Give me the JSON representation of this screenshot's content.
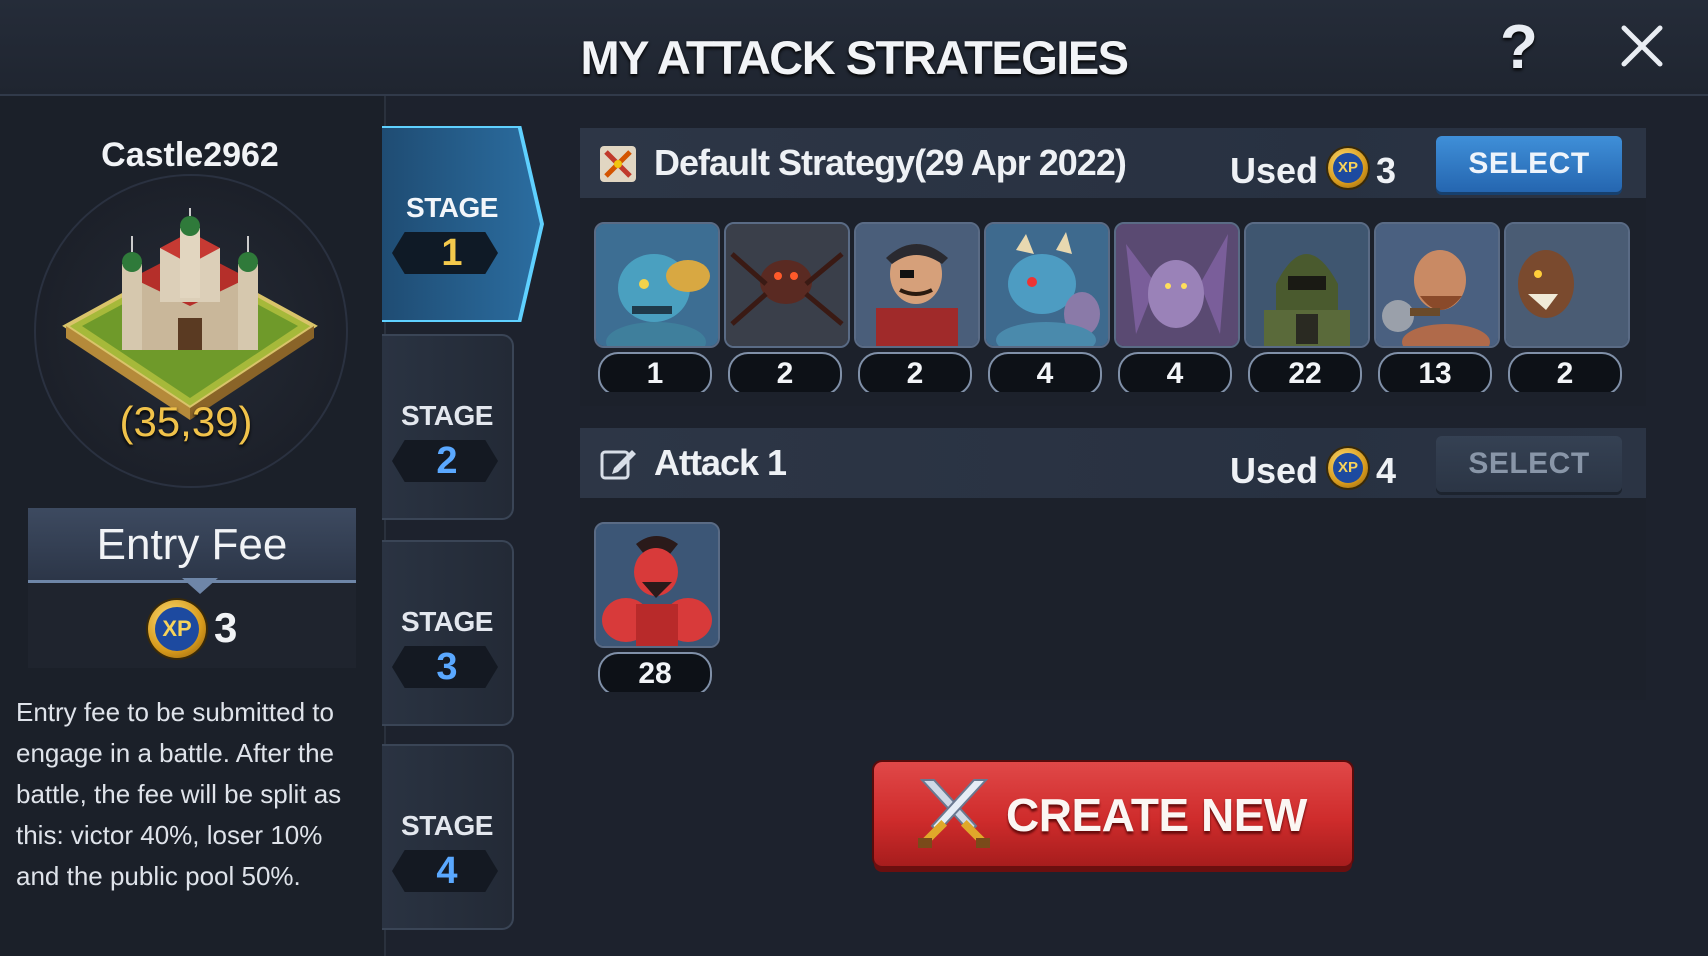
{
  "header": {
    "title": "MY ATTACK STRATEGIES",
    "help_icon": "?",
    "close_icon": "close"
  },
  "castle": {
    "name": "Castle2962",
    "coords": "(35,39)"
  },
  "entry_fee": {
    "title": "Entry Fee",
    "coin_label": "XP",
    "value": "3",
    "description": "Entry fee to be submitted to engage in a battle. After the battle, the fee will be split as this: victor 40%, loser 10% and the public pool 50%."
  },
  "stages": [
    {
      "label": "STAGE",
      "number": "1",
      "active": true
    },
    {
      "label": "STAGE",
      "number": "2",
      "active": false
    },
    {
      "label": "STAGE",
      "number": "3",
      "active": false
    },
    {
      "label": "STAGE",
      "number": "4",
      "active": false
    }
  ],
  "strategies": [
    {
      "name": "Default Strategy(29 Apr 2022)",
      "icon": "crossed-swords-icon",
      "used_label": "Used",
      "coin_label": "XP",
      "used_count": "3",
      "select_label": "SELECT",
      "select_enabled": true,
      "units": [
        "1",
        "2",
        "2",
        "4",
        "4",
        "22",
        "13",
        "2"
      ]
    },
    {
      "name": "Attack 1",
      "icon": "edit-icon",
      "used_label": "Used",
      "coin_label": "XP",
      "used_count": "4",
      "select_label": "SELECT",
      "select_enabled": false,
      "units": [
        "28"
      ]
    }
  ],
  "create_button": {
    "label": "CREATE NEW",
    "icon": "crossed-swords-icon"
  },
  "colors": {
    "accent_blue": "#2b6da0",
    "gold": "#f0c24a",
    "create_red": "#cf2c2c",
    "bg": "#1d222d"
  }
}
